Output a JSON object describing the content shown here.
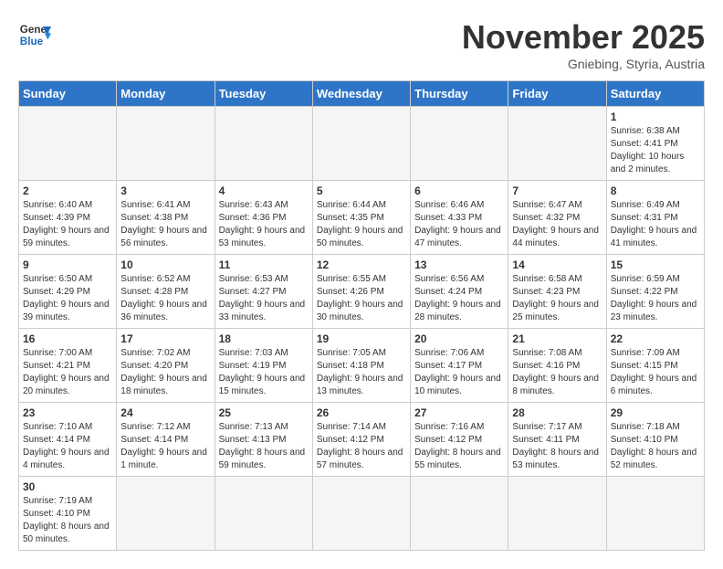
{
  "header": {
    "logo_general": "General",
    "logo_blue": "Blue",
    "month_title": "November 2025",
    "subtitle": "Gniebing, Styria, Austria"
  },
  "weekdays": [
    "Sunday",
    "Monday",
    "Tuesday",
    "Wednesday",
    "Thursday",
    "Friday",
    "Saturday"
  ],
  "weeks": [
    [
      {
        "day": "",
        "info": ""
      },
      {
        "day": "",
        "info": ""
      },
      {
        "day": "",
        "info": ""
      },
      {
        "day": "",
        "info": ""
      },
      {
        "day": "",
        "info": ""
      },
      {
        "day": "",
        "info": ""
      },
      {
        "day": "1",
        "info": "Sunrise: 6:38 AM\nSunset: 4:41 PM\nDaylight: 10 hours and 2 minutes."
      }
    ],
    [
      {
        "day": "2",
        "info": "Sunrise: 6:40 AM\nSunset: 4:39 PM\nDaylight: 9 hours and 59 minutes."
      },
      {
        "day": "3",
        "info": "Sunrise: 6:41 AM\nSunset: 4:38 PM\nDaylight: 9 hours and 56 minutes."
      },
      {
        "day": "4",
        "info": "Sunrise: 6:43 AM\nSunset: 4:36 PM\nDaylight: 9 hours and 53 minutes."
      },
      {
        "day": "5",
        "info": "Sunrise: 6:44 AM\nSunset: 4:35 PM\nDaylight: 9 hours and 50 minutes."
      },
      {
        "day": "6",
        "info": "Sunrise: 6:46 AM\nSunset: 4:33 PM\nDaylight: 9 hours and 47 minutes."
      },
      {
        "day": "7",
        "info": "Sunrise: 6:47 AM\nSunset: 4:32 PM\nDaylight: 9 hours and 44 minutes."
      },
      {
        "day": "8",
        "info": "Sunrise: 6:49 AM\nSunset: 4:31 PM\nDaylight: 9 hours and 41 minutes."
      }
    ],
    [
      {
        "day": "9",
        "info": "Sunrise: 6:50 AM\nSunset: 4:29 PM\nDaylight: 9 hours and 39 minutes."
      },
      {
        "day": "10",
        "info": "Sunrise: 6:52 AM\nSunset: 4:28 PM\nDaylight: 9 hours and 36 minutes."
      },
      {
        "day": "11",
        "info": "Sunrise: 6:53 AM\nSunset: 4:27 PM\nDaylight: 9 hours and 33 minutes."
      },
      {
        "day": "12",
        "info": "Sunrise: 6:55 AM\nSunset: 4:26 PM\nDaylight: 9 hours and 30 minutes."
      },
      {
        "day": "13",
        "info": "Sunrise: 6:56 AM\nSunset: 4:24 PM\nDaylight: 9 hours and 28 minutes."
      },
      {
        "day": "14",
        "info": "Sunrise: 6:58 AM\nSunset: 4:23 PM\nDaylight: 9 hours and 25 minutes."
      },
      {
        "day": "15",
        "info": "Sunrise: 6:59 AM\nSunset: 4:22 PM\nDaylight: 9 hours and 23 minutes."
      }
    ],
    [
      {
        "day": "16",
        "info": "Sunrise: 7:00 AM\nSunset: 4:21 PM\nDaylight: 9 hours and 20 minutes."
      },
      {
        "day": "17",
        "info": "Sunrise: 7:02 AM\nSunset: 4:20 PM\nDaylight: 9 hours and 18 minutes."
      },
      {
        "day": "18",
        "info": "Sunrise: 7:03 AM\nSunset: 4:19 PM\nDaylight: 9 hours and 15 minutes."
      },
      {
        "day": "19",
        "info": "Sunrise: 7:05 AM\nSunset: 4:18 PM\nDaylight: 9 hours and 13 minutes."
      },
      {
        "day": "20",
        "info": "Sunrise: 7:06 AM\nSunset: 4:17 PM\nDaylight: 9 hours and 10 minutes."
      },
      {
        "day": "21",
        "info": "Sunrise: 7:08 AM\nSunset: 4:16 PM\nDaylight: 9 hours and 8 minutes."
      },
      {
        "day": "22",
        "info": "Sunrise: 7:09 AM\nSunset: 4:15 PM\nDaylight: 9 hours and 6 minutes."
      }
    ],
    [
      {
        "day": "23",
        "info": "Sunrise: 7:10 AM\nSunset: 4:14 PM\nDaylight: 9 hours and 4 minutes."
      },
      {
        "day": "24",
        "info": "Sunrise: 7:12 AM\nSunset: 4:14 PM\nDaylight: 9 hours and 1 minute."
      },
      {
        "day": "25",
        "info": "Sunrise: 7:13 AM\nSunset: 4:13 PM\nDaylight: 8 hours and 59 minutes."
      },
      {
        "day": "26",
        "info": "Sunrise: 7:14 AM\nSunset: 4:12 PM\nDaylight: 8 hours and 57 minutes."
      },
      {
        "day": "27",
        "info": "Sunrise: 7:16 AM\nSunset: 4:12 PM\nDaylight: 8 hours and 55 minutes."
      },
      {
        "day": "28",
        "info": "Sunrise: 7:17 AM\nSunset: 4:11 PM\nDaylight: 8 hours and 53 minutes."
      },
      {
        "day": "29",
        "info": "Sunrise: 7:18 AM\nSunset: 4:10 PM\nDaylight: 8 hours and 52 minutes."
      }
    ],
    [
      {
        "day": "30",
        "info": "Sunrise: 7:19 AM\nSunset: 4:10 PM\nDaylight: 8 hours and 50 minutes."
      },
      {
        "day": "",
        "info": ""
      },
      {
        "day": "",
        "info": ""
      },
      {
        "day": "",
        "info": ""
      },
      {
        "day": "",
        "info": ""
      },
      {
        "day": "",
        "info": ""
      },
      {
        "day": "",
        "info": ""
      }
    ]
  ]
}
